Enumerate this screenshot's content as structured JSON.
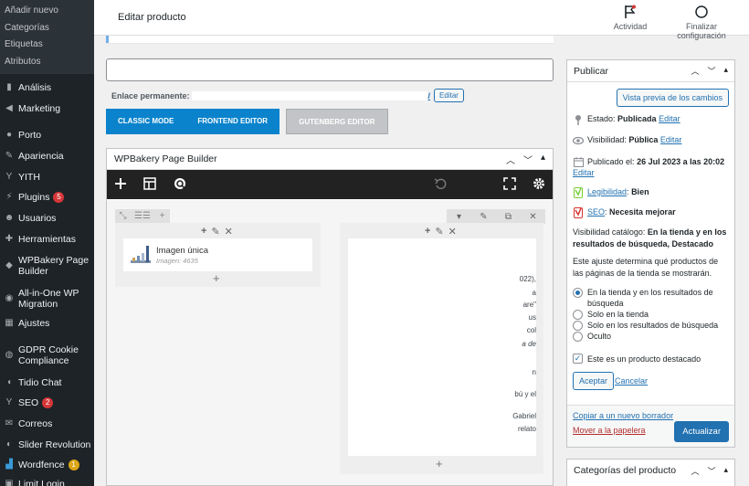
{
  "sidebar": {
    "submenu": [
      "Añadir nuevo",
      "Categorías",
      "Etiquetas",
      "Atributos"
    ],
    "items": [
      {
        "label": "Análisis",
        "icon": "bar-chart-icon"
      },
      {
        "label": "Marketing",
        "icon": "megaphone-icon"
      },
      {
        "label": "Porto",
        "icon": "porto-icon"
      },
      {
        "label": "Apariencia",
        "icon": "paintbrush-icon"
      },
      {
        "label": "YITH",
        "icon": "yith-icon"
      },
      {
        "label": "Plugins",
        "icon": "plugin-icon",
        "badge": "5"
      },
      {
        "label": "Usuarios",
        "icon": "users-icon"
      },
      {
        "label": "Herramientas",
        "icon": "wrench-icon"
      },
      {
        "label": "WPBakery Page Builder",
        "icon": "wpbakery-icon"
      },
      {
        "label": "All-in-One WP Migration",
        "icon": "migration-icon"
      },
      {
        "label": "Ajustes",
        "icon": "settings-icon"
      },
      {
        "label": "GDPR Cookie Compliance",
        "icon": "cookie-icon"
      },
      {
        "label": "Tidio Chat",
        "icon": "chat-icon"
      },
      {
        "label": "SEO",
        "icon": "yoast-icon",
        "badge": "2"
      },
      {
        "label": "Correos",
        "icon": "mail-icon"
      },
      {
        "label": "Slider Revolution",
        "icon": "slider-icon"
      },
      {
        "label": "Wordfence",
        "icon": "wordfence-icon",
        "badge": "1"
      },
      {
        "label": "Limit Login",
        "icon": "lock-icon"
      }
    ]
  },
  "topbar": {
    "title": "Editar producto",
    "activity_label": "Actividad",
    "finish_label": "Finalizar configuración"
  },
  "permalink": {
    "label": "Enlace permanente:",
    "slash": "/",
    "edit_label": "Editar"
  },
  "editor_tabs": {
    "classic": "CLASSIC MODE",
    "frontend": "FRONTEND EDITOR",
    "gutenberg": "GUTENBERG EDITOR"
  },
  "wpbakery": {
    "title": "WPBakery Page Builder",
    "element_title": "Imagen única",
    "element_sub": "Imagen: 4635",
    "text_fragments": [
      "022),",
      "a",
      "are\"",
      "us",
      "col",
      "a de",
      "n",
      "bú y el",
      "Gabriel",
      "relato"
    ]
  },
  "publish": {
    "title": "Publicar",
    "preview_label": "Vista previa de los cambios",
    "status_label": "Estado:",
    "status_value": "Publicada",
    "status_edit": "Editar",
    "visibility_label": "Visibilidad:",
    "visibility_value": "Pública",
    "visibility_edit": "Editar",
    "published_label": "Publicado el:",
    "published_value": "26 Jul 2023 a las 20:02",
    "published_edit": "Editar",
    "readability_label": "Legibilidad",
    "readability_value": "Bien",
    "seo_label": "SEO",
    "seo_value": "Necesita mejorar",
    "catalog_label": "Visibilidad catálogo:",
    "catalog_value": "En la tienda y en los resultados de búsqueda, Destacado",
    "catalog_help": "Este ajuste determina qué productos de las páginas de la tienda se mostrarán.",
    "options": [
      {
        "label": "En la tienda y en los resultados de búsqueda",
        "checked": true
      },
      {
        "label": "Solo en la tienda",
        "checked": false
      },
      {
        "label": "Solo en los resultados de búsqueda",
        "checked": false
      },
      {
        "label": "Oculto",
        "checked": false
      }
    ],
    "featured_label": "Este es un producto destacado",
    "featured_checked": true,
    "accept_label": "Aceptar",
    "cancel_label": "Cancelar",
    "copy_label": "Copiar a un nuevo borrador",
    "trash_label": "Mover a la papelera",
    "update_label": "Actualizar"
  },
  "categories_box": {
    "title": "Categorías del producto"
  },
  "colors": {
    "sidebar_bg": "#1d2327",
    "accent": "#2271b1",
    "wpb_blue": "#0a83cc",
    "badge_red": "#d63638",
    "badge_yellow": "#dba617",
    "readability_good": "#7ad03a",
    "seo_bad": "#dc3232"
  }
}
